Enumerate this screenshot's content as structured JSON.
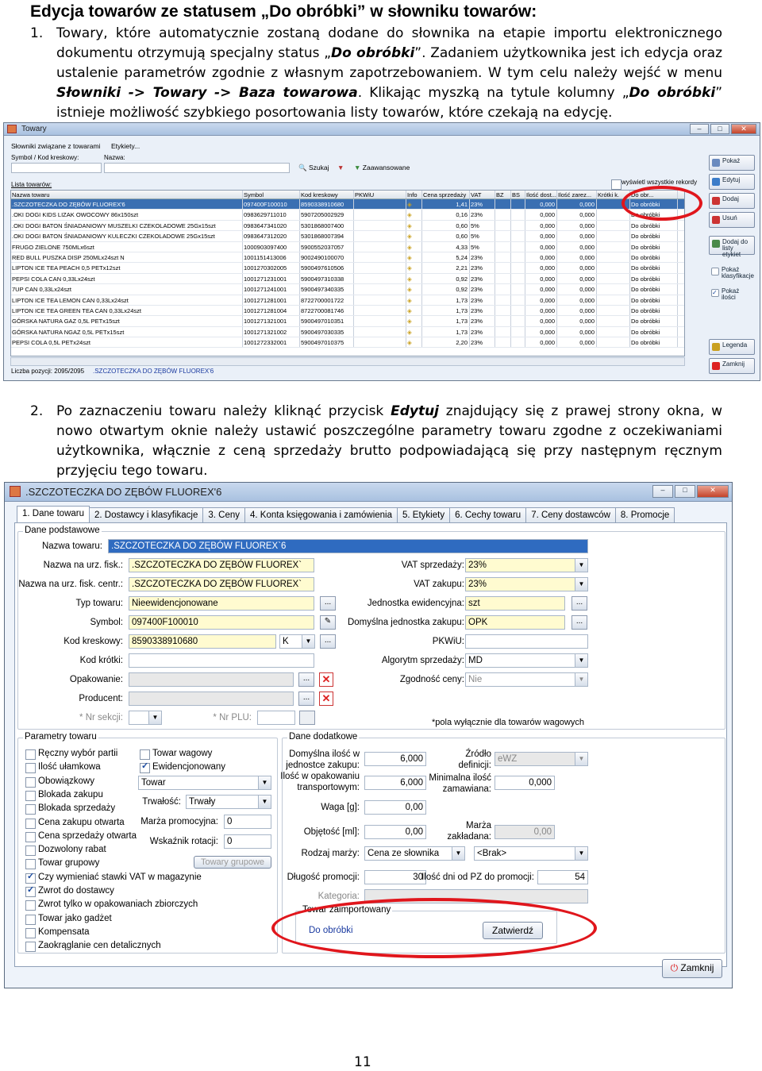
{
  "heading": "Edycja towarów ze statusem „Do obróbki” w słowniku towarów:",
  "step1": {
    "num": "1.",
    "text_a": "Towary, które automatycznie zostaną dodane do słownika na etapie importu elektronicznego dokumentu otrzymują specjalny status „",
    "em1": "Do obróbki",
    "text_b": "”. Zadaniem użytkownika jest ich edycja oraz ustalenie parametrów zgodnie z własnym zapotrzebowaniem. W tym celu należy wejść w menu ",
    "em2": "Słowniki -> Towary -> Baza towarowa",
    "text_c": ". Klikając myszką na tytule kolumny „",
    "em3": "Do obróbki",
    "text_d": "” istnieje możliwość szybkiego posortowania listy towarów, które czekają na edycję."
  },
  "step2": {
    "num": "2.",
    "text_a": "Po zaznaczeniu towaru należy kliknąć przycisk ",
    "em1": "Edytuj",
    "text_b": " znajdujący się z prawej strony okna, w nowo otwartym oknie należy ustawić poszczególne parametry towaru zgodne z oczekiwaniami użytkownika, włącznie z ceną sprzedaży brutto podpowiadającą się przy następnym ręcznym przyjęciu tego towaru."
  },
  "page_number": "11",
  "window1": {
    "title": "Towary",
    "menu": [
      "Słowniki związane z towarami",
      "Etykiety..."
    ],
    "symbol_label": "Symbol / Kod kreskowy:",
    "name_label": "Nazwa:",
    "search_btn": "Szukaj",
    "advanced_btn": "Zaawansowane",
    "list_label": "Lista towarów:",
    "show_all": "wyświetl wszystkie rekordy",
    "columns": [
      "Nazwa towaru",
      "Symbol",
      "Kod kreskowy",
      "PKWiU",
      "Info",
      "Cena sprzedaży",
      "VAT",
      "BZ",
      "BS",
      "Ilość dost...",
      "Ilość zarez...",
      "Krótki k.",
      "Do obr..."
    ],
    "rows": [
      [
        ".SZCZOTECZKA DO ZĘBÓW FLUOREX'6",
        "097400F100010",
        "8590338910680",
        "",
        "",
        "1,41",
        "23%",
        "",
        "",
        "0,000",
        "0,000",
        "",
        "Do obróbki"
      ],
      [
        ".OKI DOGI KIDS LIZAK OWOCOWY 86x150szt",
        "0983629711010",
        "5907205002929",
        "",
        "",
        "0,16",
        "23%",
        "",
        "",
        "0,000",
        "0,000",
        "",
        "Do obróbki"
      ],
      [
        ".OKI DOGI BATON ŚNIADANIOWY MUSZELKI CZEKOLADOWE 25Gx15szt",
        "0983647341020",
        "5301868007400",
        "",
        "",
        "0,60",
        "5%",
        "",
        "",
        "0,000",
        "0,000",
        "",
        "Do obróbki"
      ],
      [
        ".OKI DOGI BATON ŚNIADANIOWY KULECZKI CZEKOLADOWE 25Gx15szt",
        "0983647312020",
        "5301868007394",
        "",
        "",
        "0,60",
        "5%",
        "",
        "",
        "0,000",
        "0,000",
        "",
        "Do obróbki"
      ],
      [
        "FRUGO ZIELONE 750MLx6szt",
        "1000903097400",
        "5900552037057",
        "",
        "",
        "4,33",
        "5%",
        "",
        "",
        "0,000",
        "0,000",
        "",
        "Do obróbki"
      ],
      [
        "RED BULL PUSZKA DISP 250MLx24szt N",
        "1001151413006",
        "9002490100070",
        "",
        "",
        "5,24",
        "23%",
        "",
        "",
        "0,000",
        "0,000",
        "",
        "Do obróbki"
      ],
      [
        "LIPTON ICE TEA PEACH 0,5 PETx12szt",
        "1001270302005",
        "5900497610506",
        "",
        "",
        "2,21",
        "23%",
        "",
        "",
        "0,000",
        "0,000",
        "",
        "Do obróbki"
      ],
      [
        "PEPSI COLA CAN 0,33Lx24szt",
        "1001271231001",
        "5900497310338",
        "",
        "",
        "0,92",
        "23%",
        "",
        "",
        "0,000",
        "0,000",
        "",
        "Do obróbki"
      ],
      [
        "7UP CAN 0,33Lx24szt",
        "1001271241001",
        "5900497340335",
        "",
        "",
        "0,92",
        "23%",
        "",
        "",
        "0,000",
        "0,000",
        "",
        "Do obróbki"
      ],
      [
        "LIPTON ICE TEA LEMON CAN 0,33Lx24szt",
        "1001271281001",
        "8722700001722",
        "",
        "",
        "1,73",
        "23%",
        "",
        "",
        "0,000",
        "0,000",
        "",
        "Do obróbki"
      ],
      [
        "LIPTON ICE TEA GREEN TEA CAN 0,33Lx24szt",
        "1001271281004",
        "8722700081746",
        "",
        "",
        "1,73",
        "23%",
        "",
        "",
        "0,000",
        "0,000",
        "",
        "Do obróbki"
      ],
      [
        "GÓRSKA NATURA GAZ 0,5L PETx15szt",
        "1001271321001",
        "5900497010351",
        "",
        "",
        "1,73",
        "23%",
        "",
        "",
        "0,000",
        "0,000",
        "",
        "Do obróbki"
      ],
      [
        "GÓRSKA NATURA NGAZ 0,5L PETx15szt",
        "1001271321002",
        "5900497030335",
        "",
        "",
        "1,73",
        "23%",
        "",
        "",
        "0,000",
        "0,000",
        "",
        "Do obróbki"
      ],
      [
        "PEPSI COLA 0,5L PETx24szt",
        "1001272332001",
        "5900497010375",
        "",
        "",
        "2,20",
        "23%",
        "",
        "",
        "0,000",
        "0,000",
        "",
        "Do obróbki"
      ]
    ],
    "status": "Liczba pozycji: 2095/2095",
    "status_item": ".SZCZOTECZKA DO ZĘBÓW FLUOREX'6",
    "side_buttons": [
      "Pokaż",
      "Edytuj",
      "Dodaj",
      "Usuń",
      "Dodaj do listy etykiet",
      "Pokaż klasyfikacje",
      "Pokaż ilości",
      "Legenda",
      "Zamknij"
    ]
  },
  "window2": {
    "title": ".SZCZOTECZKA DO ZĘBÓW FLUOREX'6",
    "tabs": [
      "1. Dane towaru",
      "2. Dostawcy i klasyfikacje",
      "3. Ceny",
      "4. Konta księgowania i zamówienia",
      "5. Etykiety",
      "6. Cechy towaru",
      "7. Ceny dostawców",
      "8. Promocje"
    ],
    "basic_group": "Dane podstawowe",
    "name_label": "Nazwa towaru:",
    "name_value": ".SZCZOTECZKA DO ZĘBÓW FLUOREX`6",
    "fisk_label": "Nazwa na urz. fisk.:",
    "fisk_value": ".SZCZOTECZKA DO ZĘBÓW FLUOREX`",
    "fiskc_label": "Nazwa na urz. fisk. centr.:",
    "fiskc_value": ".SZCZOTECZKA DO ZĘBÓW FLUOREX`",
    "type_label": "Typ towaru:",
    "type_value": "Nieewidencjonowane",
    "symbol_label": "Symbol:",
    "symbol_value": "097400F100010",
    "barcode_label": "Kod kreskowy:",
    "barcode_value": "8590338910680",
    "barcode_type": "K",
    "short_label": "Kod krótki:",
    "pack_label": "Opakowanie:",
    "producer_label": "Producent:",
    "section_label": "* Nr sekcji:",
    "plu_label": "* Nr PLU:",
    "vat_sale_label": "VAT sprzedaży:",
    "vat_sale_value": "23%",
    "vat_buy_label": "VAT zakupu:",
    "vat_buy_value": "23%",
    "unit_label": "Jednostka ewidencyjna:",
    "unit_value": "szt",
    "def_unit_label": "Domyślna jednostka zakupu:",
    "def_unit_value": "OPK",
    "pkwiu_label": "PKWiU:",
    "algo_label": "Algorytm sprzedaży:",
    "algo_value": "MD",
    "price_label": "Zgodność ceny:",
    "price_value": "Nie",
    "note": "*pola wyłącznie dla towarów wagowych",
    "params_group": "Parametry towaru",
    "checks_left": [
      {
        "label": "Ręczny wybór partii",
        "on": false
      },
      {
        "label": "Ilość ułamkowa",
        "on": false
      },
      {
        "label": "Obowiązkowy",
        "on": false
      },
      {
        "label": "Blokada zakupu",
        "on": false
      },
      {
        "label": "Blokada sprzedaży",
        "on": false
      },
      {
        "label": "Cena zakupu otwarta",
        "on": false
      },
      {
        "label": "Cena sprzedaży otwarta",
        "on": false
      },
      {
        "label": "Dozwolony rabat",
        "on": false
      },
      {
        "label": "Towar grupowy",
        "on": false
      },
      {
        "label": "Czy wymieniać stawki VAT w magazynie",
        "on": true
      },
      {
        "label": "Zwrot do dostawcy",
        "on": true
      },
      {
        "label": "Zwrot tylko w opakowaniach zbiorczych",
        "on": false
      },
      {
        "label": "Towar jako gadżet",
        "on": false
      },
      {
        "label": "Kompensata",
        "on": false
      },
      {
        "label": "Zaokrąglanie cen detalicznych",
        "on": false
      }
    ],
    "check_weight": "Towar wagowy",
    "check_registered": "Ewidencjonowany",
    "kind_value": "Towar",
    "durability_label": "Trwałość:",
    "durability_value": "Trwały",
    "promo_margin_label": "Marża promocyjna:",
    "promo_margin_value": "0",
    "rotation_label": "Wskaźnik rotacji:",
    "rotation_value": "0",
    "group_goods_btn": "Towary grupowe",
    "extra_group": "Dane dodatkowe",
    "def_qty_label_1": "Domyślna ilość w",
    "def_qty_label_2": "jednostce zakupu:",
    "def_qty_value": "6,000",
    "pack_qty_label_1": "Ilość w opakowaniu",
    "pack_qty_label_2": "transportowym:",
    "pack_qty_value": "6,000",
    "weight_label": "Waga [g]:",
    "weight_value": "0,00",
    "volume_label": "Objętość [ml]:",
    "volume_value": "0,00",
    "margin_kind_label": "Rodzaj marży:",
    "margin_kind_value": "Cena ze słownika",
    "brak_value": "<Brak>",
    "promo_len_label": "Długość promocji:",
    "promo_len_value": "30",
    "days_label": "Ilość dni od PZ do promocji:",
    "days_value": "54",
    "source_label_1": "Źródło",
    "source_label_2": "definicji:",
    "source_value": "eWZ",
    "min_qty_label_1": "Minimalna ilość",
    "min_qty_label_2": "zamawiana:",
    "min_qty_value": "0,000",
    "margin_label_1": "Marża",
    "margin_label_2": "zakładana:",
    "margin_value": "0,00",
    "category_label": "Kategoria:",
    "imported_group": "Towar zaimportowany",
    "imported_status": "Do obróbki",
    "confirm_btn": "Zatwierdź",
    "close_btn": "Zamknij"
  }
}
